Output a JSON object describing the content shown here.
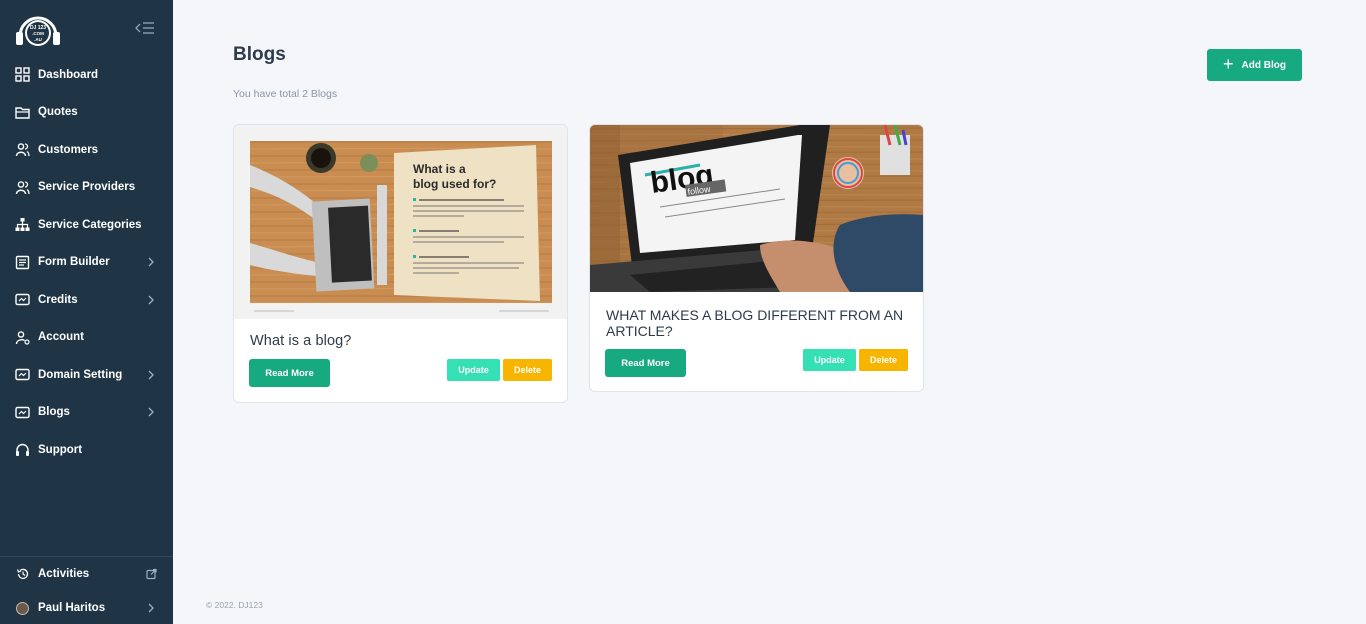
{
  "brand": {
    "logo_text": "DJ 123 .COM .AU"
  },
  "sidebar": {
    "items": [
      {
        "label": "Dashboard",
        "icon": "dashboard-icon",
        "has_submenu": false
      },
      {
        "label": "Quotes",
        "icon": "folder-icon",
        "has_submenu": false
      },
      {
        "label": "Customers",
        "icon": "users-icon",
        "has_submenu": false
      },
      {
        "label": "Service Providers",
        "icon": "users-icon",
        "has_submenu": false
      },
      {
        "label": "Service Categories",
        "icon": "hierarchy-icon",
        "has_submenu": false
      },
      {
        "label": "Form Builder",
        "icon": "form-icon",
        "has_submenu": true
      },
      {
        "label": "Credits",
        "icon": "card-icon",
        "has_submenu": true
      },
      {
        "label": "Account",
        "icon": "user-settings-icon",
        "has_submenu": false
      },
      {
        "label": "Domain Setting",
        "icon": "card-icon",
        "has_submenu": true
      },
      {
        "label": "Blogs",
        "icon": "card-icon",
        "has_submenu": true
      },
      {
        "label": "Support",
        "icon": "headphones-icon",
        "has_submenu": false
      }
    ],
    "bottom": {
      "activities": "Activities",
      "user_name": "Paul Haritos"
    }
  },
  "main": {
    "title": "Blogs",
    "subtitle": "You have total 2 Blogs",
    "add_button": "Add Blog",
    "blogs": [
      {
        "title": "What is a blog?",
        "image_heading": "What is a blog used for?",
        "read_more": "Read More",
        "update": "Update",
        "delete": "Delete"
      },
      {
        "title": "WHAT MAKES A BLOG DIFFERENT FROM AN ARTICLE?",
        "image_heading": "blog",
        "read_more": "Read More",
        "update": "Update",
        "delete": "Delete"
      }
    ],
    "footer": "© 2022. DJ123"
  },
  "colors": {
    "sidebar_bg": "#1f3445",
    "primary_green": "#17a97f",
    "update_teal": "#35e0b5",
    "delete_yellow": "#f7b500"
  }
}
